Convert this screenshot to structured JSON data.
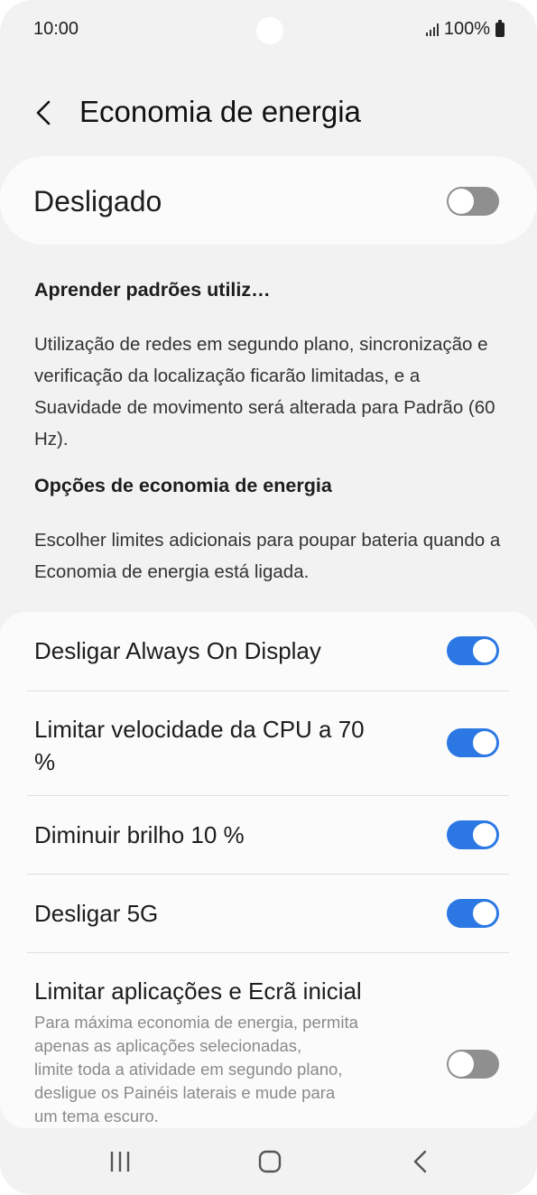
{
  "status_bar": {
    "time": "10:00",
    "battery_percent": "100%"
  },
  "header": {
    "title": "Economia de energia"
  },
  "master": {
    "label": "Desligado",
    "enabled": false
  },
  "learn": {
    "title": "Aprender padrões utiliz…"
  },
  "description": "Utilização de redes em segundo plano, sincronização e verificação da localização ficarão limitadas, e a Suavidade de movimento será alterada para Padrão (60 Hz).",
  "options_section": {
    "heading": "Opções de economia de energia",
    "description": "Escolher limites adicionais para poupar bateria quando a Economia de energia está ligada."
  },
  "options": [
    {
      "label": "Desligar Always On Display",
      "enabled": true
    },
    {
      "label_line1": "Limitar velocidade da CPU a 70",
      "label_line2": "%",
      "enabled": true
    },
    {
      "label": "Diminuir brilho 10 %",
      "enabled": true
    },
    {
      "label": "Desligar 5G",
      "enabled": true
    },
    {
      "label": "Limitar aplicações e Ecrã inicial",
      "description_lines": [
        "Para máxima economia de energia, permita",
        "apenas as aplicações selecionadas,",
        "limite toda a atividade em segundo plano,",
        "desligue os Painéis laterais e mude para",
        "um tema escuro."
      ],
      "enabled": false
    }
  ],
  "colors": {
    "accent": "#2b78e4",
    "background": "#f2f2f2",
    "card": "#fbfbfb"
  },
  "icons": {
    "back": "chevron-left-icon",
    "nav_recents": "recents-icon",
    "nav_home": "home-icon",
    "nav_back": "back-icon"
  }
}
